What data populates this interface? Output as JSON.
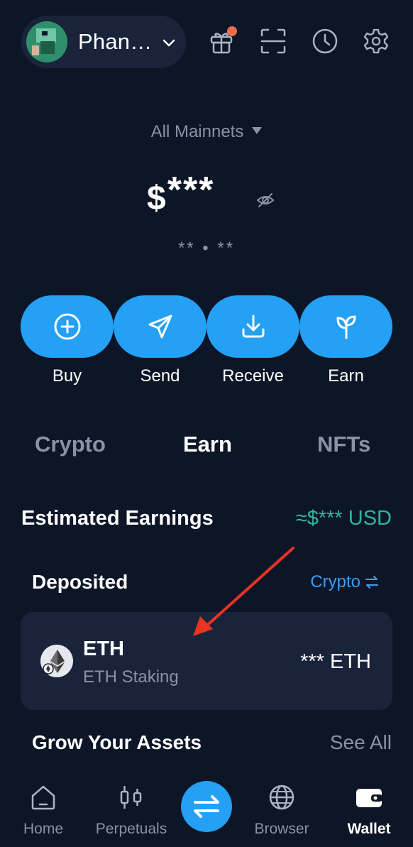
{
  "header": {
    "account_name": "Phan…",
    "icons": [
      "gift-icon",
      "scan-icon",
      "history-icon",
      "settings-icon"
    ],
    "notification_dot_color": "#f06a4d"
  },
  "network": {
    "label": "All Mainnets"
  },
  "balance": {
    "currency_symbol": "$",
    "hidden_value": "***",
    "sub_value": "** • **"
  },
  "actions": [
    {
      "label": "Buy",
      "icon": "plus-circle-icon"
    },
    {
      "label": "Send",
      "icon": "send-icon"
    },
    {
      "label": "Receive",
      "icon": "receive-icon"
    },
    {
      "label": "Earn",
      "icon": "sprout-icon"
    }
  ],
  "tabs": [
    {
      "label": "Crypto",
      "active": false
    },
    {
      "label": "Earn",
      "active": true
    },
    {
      "label": "NFTs",
      "active": false
    }
  ],
  "earnings": {
    "title": "Estimated Earnings",
    "value": "≈$*** USD"
  },
  "deposited": {
    "title": "Deposited",
    "toggle_label": "Crypto",
    "items": [
      {
        "symbol": "ETH",
        "subtitle": "ETH Staking",
        "amount": "*** ETH"
      }
    ]
  },
  "grow": {
    "title": "Grow Your Assets",
    "see_all": "See All"
  },
  "bottom_nav": [
    {
      "label": "Home",
      "icon": "home-icon",
      "active": false
    },
    {
      "label": "Perpetuals",
      "icon": "candlestick-icon",
      "active": false
    },
    {
      "label": "",
      "icon": "swap-icon",
      "active": false
    },
    {
      "label": "Browser",
      "icon": "globe-icon",
      "active": false
    },
    {
      "label": "Wallet",
      "icon": "wallet-icon",
      "active": true
    }
  ],
  "colors": {
    "background": "#0d1627",
    "card": "#19243a",
    "accent": "#24a0f4",
    "earnings_green": "#2fb59a",
    "link_blue": "#3b9df5",
    "annotation_arrow": "#ea3323"
  }
}
